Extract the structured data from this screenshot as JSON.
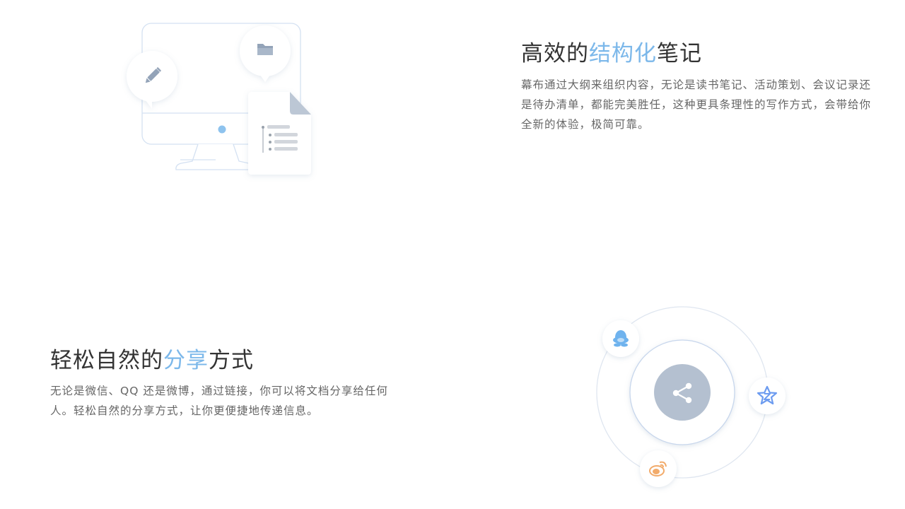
{
  "features": {
    "notes": {
      "title_pre": "高效的",
      "title_highlight": "结构化",
      "title_post": "笔记",
      "description": "幕布通过大纲来组织内容，无论是读书笔记、活动策划、会议记录还是待办清单，都能完美胜任，这种更具条理性的写作方式，会带给你全新的体验，极简可靠。",
      "illustration_icons": [
        "monitor-icon",
        "pencil-icon",
        "folder-icon",
        "outline-document-icon"
      ]
    },
    "share": {
      "title_pre": "轻松自然的",
      "title_highlight": "分享",
      "title_post": "方式",
      "description": "无论是微信、QQ 还是微博，通过链接，你可以将文档分享给任何人。轻松自然的分享方式，让你更便捷地传递信息。",
      "illustration_icons": [
        "share-icon",
        "qq-icon",
        "qzone-icon",
        "weibo-icon"
      ]
    }
  },
  "colors": {
    "highlight": "#7cb8ea",
    "title": "#333333",
    "text": "#666666",
    "share_center": "#b4c0d0",
    "qq": "#6fb3ee",
    "qzone": "#6d9cf0",
    "weibo": "#f2ab6b"
  }
}
